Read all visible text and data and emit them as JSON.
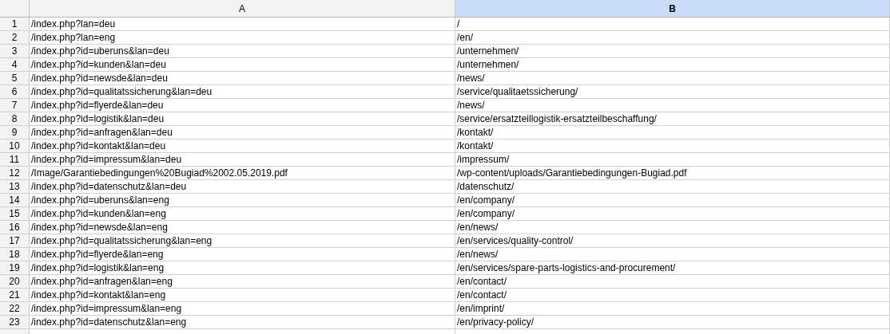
{
  "columns": [
    {
      "label": "A",
      "selected": false
    },
    {
      "label": "B",
      "selected": true
    }
  ],
  "rows": [
    {
      "number": "1",
      "cells": [
        "/index.php?lan=deu",
        "/"
      ]
    },
    {
      "number": "2",
      "cells": [
        "/index.php?lan=eng",
        "/en/"
      ]
    },
    {
      "number": "3",
      "cells": [
        "/index.php?id=uberuns&lan=deu",
        "/unternehmen/"
      ]
    },
    {
      "number": "4",
      "cells": [
        "/index.php?id=kunden&lan=deu",
        "/unternehmen/"
      ]
    },
    {
      "number": "5",
      "cells": [
        "/index.php?id=newsde&lan=deu",
        "/news/"
      ]
    },
    {
      "number": "6",
      "cells": [
        "/index.php?id=qualitatssicherung&lan=deu",
        "/service/qualitaetssicherung/"
      ]
    },
    {
      "number": "7",
      "cells": [
        "/index.php?id=flyerde&lan=deu",
        "/news/"
      ]
    },
    {
      "number": "8",
      "cells": [
        "/index.php?id=logistik&lan=deu",
        "/service/ersatzteillogistik-ersatzteilbeschaffung/"
      ]
    },
    {
      "number": "9",
      "cells": [
        "/index.php?id=anfragen&lan=deu",
        "/kontakt/"
      ]
    },
    {
      "number": "10",
      "cells": [
        "/index.php?id=kontakt&lan=deu",
        "/kontakt/"
      ]
    },
    {
      "number": "11",
      "cells": [
        "/index.php?id=impressum&lan=deu",
        "/impressum/"
      ]
    },
    {
      "number": "12",
      "cells": [
        "/Image/Garantiebedingungen%20Bugiad%2002.05.2019.pdf",
        "/wp-content/uploads/Garantiebedingungen-Bugiad.pdf"
      ]
    },
    {
      "number": "13",
      "cells": [
        "/index.php?id=datenschutz&lan=deu",
        "/datenschutz/"
      ]
    },
    {
      "number": "14",
      "cells": [
        "/index.php?id=uberuns&lan=eng",
        "/en/company/"
      ]
    },
    {
      "number": "15",
      "cells": [
        "/index.php?id=kunden&lan=eng",
        "/en/company/"
      ]
    },
    {
      "number": "16",
      "cells": [
        "/index.php?id=newsde&lan=eng",
        "/en/news/"
      ]
    },
    {
      "number": "17",
      "cells": [
        "/index.php?id=qualitatssicherung&lan=eng",
        "/en/services/quality-control/"
      ]
    },
    {
      "number": "18",
      "cells": [
        "/index.php?id=flyerde&lan=eng",
        "/en/news/"
      ]
    },
    {
      "number": "19",
      "cells": [
        "/index.php?id=logistik&lan=eng",
        "/en/services/spare-parts-logistics-and-procurement/"
      ]
    },
    {
      "number": "20",
      "cells": [
        "/index.php?id=anfragen&lan=eng",
        "/en/contact/"
      ]
    },
    {
      "number": "21",
      "cells": [
        "/index.php?id=kontakt&lan=eng",
        "/en/contact/"
      ]
    },
    {
      "number": "22",
      "cells": [
        "/index.php?id=impressum&lan=eng",
        "/en/imprint/"
      ]
    },
    {
      "number": "23",
      "cells": [
        "/index.php?id=datenschutz&lan=eng",
        "/en/privacy-policy/"
      ]
    }
  ]
}
